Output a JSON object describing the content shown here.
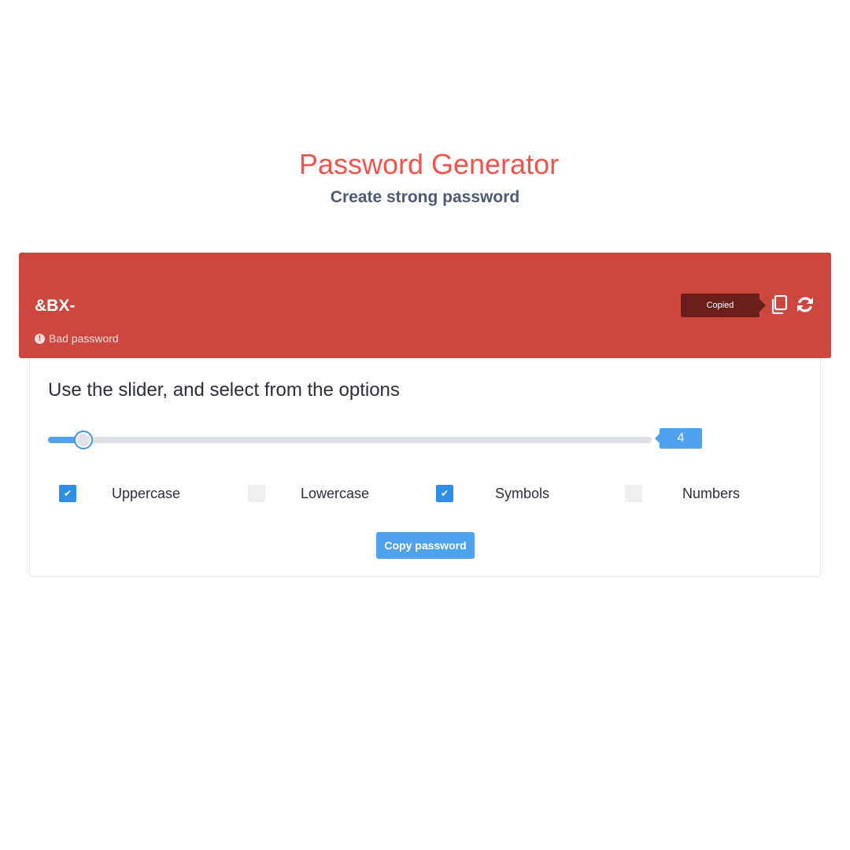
{
  "header": {
    "title": "Password Generator",
    "subtitle": "Create strong password"
  },
  "result": {
    "password": "&BX-",
    "strength_label": "Bad password",
    "tooltip": "Copied",
    "copy_icon": "copy-icon",
    "refresh_icon": "refresh-icon",
    "background_color": "#cc4740"
  },
  "options": {
    "instructions": "Use the slider, and select from the options",
    "slider": {
      "value": "4",
      "min": 4,
      "max": 32
    },
    "checkboxes": [
      {
        "label": "Uppercase",
        "checked": true
      },
      {
        "label": "Lowercase",
        "checked": false
      },
      {
        "label": "Symbols",
        "checked": true
      },
      {
        "label": "Numbers",
        "checked": false
      }
    ],
    "copy_button_label": "Copy password"
  },
  "colors": {
    "title": "#f2544c",
    "accent": "#4ea2ee",
    "checkbox_checked": "#2f8fe6"
  }
}
